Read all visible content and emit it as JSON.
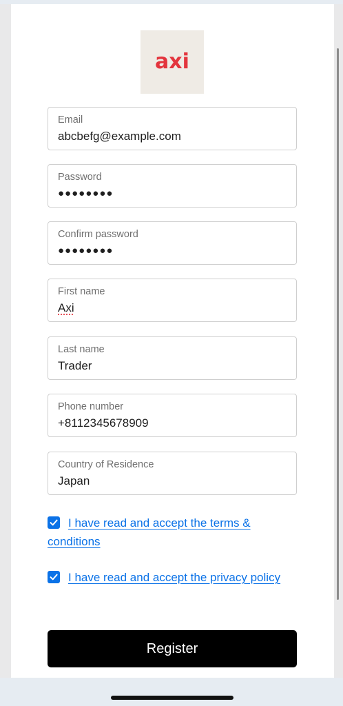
{
  "logo": {
    "text": "axi"
  },
  "form": {
    "email": {
      "label": "Email",
      "value": "abcbefg@example.com"
    },
    "password": {
      "label": "Password",
      "value": "●●●●●●●●"
    },
    "confirm_password": {
      "label": "Confirm password",
      "value": "●●●●●●●●"
    },
    "first_name": {
      "label": "First name",
      "value": "Axi"
    },
    "last_name": {
      "label": "Last name",
      "value": "Trader"
    },
    "phone": {
      "label": "Phone number",
      "value": "+8112345678909"
    },
    "country": {
      "label": "Country of Residence",
      "value": "Japan"
    }
  },
  "checks": {
    "terms": {
      "label": "I have read and accept the terms & conditions",
      "checked": true
    },
    "privacy": {
      "label": "I have read and accept the privacy policy",
      "checked": true
    }
  },
  "register": {
    "label": "Register"
  },
  "colors": {
    "brand": "#e3343d",
    "link": "#0b72e7",
    "button": "#000000"
  }
}
